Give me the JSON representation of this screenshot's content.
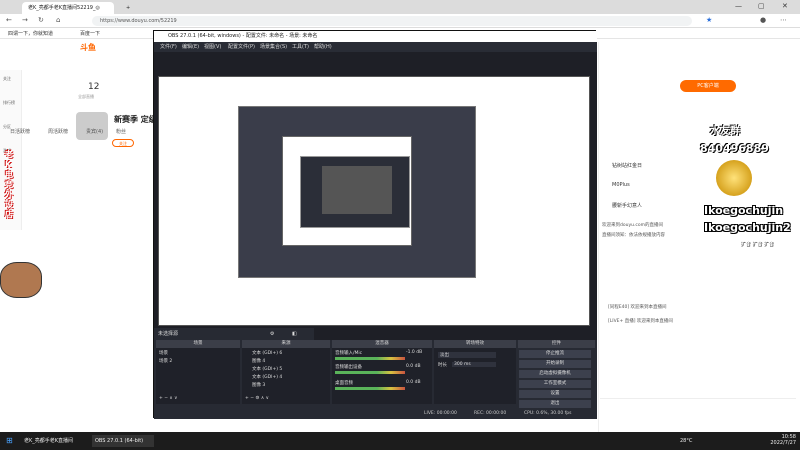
{
  "browser": {
    "tabs": [
      {
        "label": "老K_亮都手老K直播间52219_◎"
      },
      {
        "label": "+"
      }
    ],
    "url": "https://www.douyu.com/52219",
    "bookmarks": [
      "四谓一下，你就知道",
      "百度一下"
    ]
  },
  "page": {
    "logo": "斗鱼",
    "stats": {
      "number": "12",
      "label": "全部直播"
    },
    "streamer": {
      "name": "新赛季 定级",
      "follow_label": "关注"
    },
    "pc_button": "PC客户端",
    "left_sidebar": [
      "关注",
      "排行榜",
      "分区",
      "游戏"
    ],
    "vertical_banner": "老K电竞外设店",
    "chat": {
      "tabs": [
        "日活跃榜",
        "周活跃榜",
        "贵宾(4)",
        "粉丝"
      ],
      "rank_rows": [
        {
          "rank": "1",
          "name": "钻树站红金日"
        },
        {
          "rank": "2",
          "name": "M0Plus"
        },
        {
          "rank": "3",
          "name": "腰斩手幻意人"
        }
      ],
      "messages": [
        "欢迎来到douyu.com的直播间",
        "直播间须知：依法依规播放内容",
        "[同程E40] 欢迎来到本直播间",
        "[LIVE+ 直播] 欢迎来到本直播间"
      ]
    },
    "overlay": {
      "top_text": "水友群",
      "number": "840496889",
      "kid_line1": "Ikoegochujin",
      "kid_line2": "Ikoegochujin2",
      "small": "扩音 扩音 扩音"
    }
  },
  "obs": {
    "title": "OBS 27.0.1 (64-bit, windows) - 配置文件: 未命名 - 场景: 未命名",
    "menu": [
      "文件(F)",
      "编辑(E)",
      "视图(V)",
      "配置文件(P)",
      "场景集合(S)",
      "工具(T)",
      "帮助(H)"
    ],
    "src_tab_label": "未选择源",
    "docks": {
      "scenes": {
        "header": "场景",
        "items": [
          "场景",
          "场景 2"
        ]
      },
      "sources": {
        "header": "来源",
        "items": [
          "文本 (GDI+) 6",
          "图像 4",
          "文本 (GDI+) 5",
          "文本 (GDI+) 4",
          "图像 3"
        ]
      },
      "mixer": {
        "header": "混音器",
        "items": [
          {
            "name": "音频输入/Mic",
            "db": "-1.0 dB"
          },
          {
            "name": "音频输出设备",
            "db": "0.0 dB"
          },
          {
            "name": "桌面音频",
            "db": "0.0 dB"
          }
        ]
      },
      "transitions": {
        "header": "转场特效",
        "effect": "淡出",
        "duration_label": "时长",
        "duration": "300 ms"
      },
      "controls": {
        "header": "控件",
        "buttons": [
          "停止推流",
          "开始录制",
          "启动虚拟摄像机",
          "工作室模式",
          "设置",
          "退出"
        ]
      }
    },
    "status": {
      "live": "LIVE: 00:00:00",
      "rec": "REC: 00:00:00",
      "cpu": "CPU: 0.6%, 30.00 fps"
    }
  },
  "taskbar": {
    "items": [
      "老K_亮都手老K直播间",
      "OBS 27.0.1 (64-bit)"
    ],
    "temperature": "28°C",
    "time": "10:58",
    "date": "2022/7/27"
  }
}
